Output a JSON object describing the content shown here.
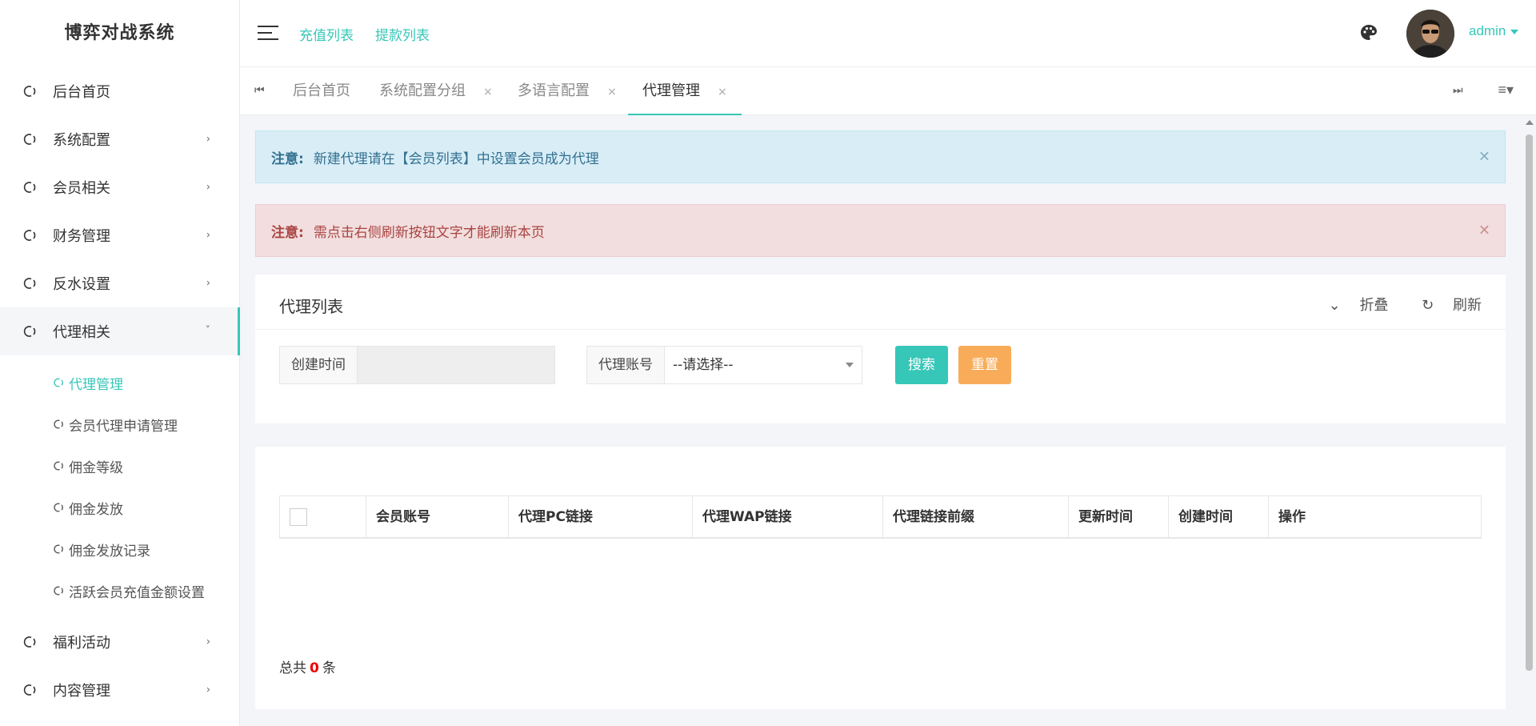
{
  "app": {
    "title": "博弈对战系统"
  },
  "sidebar": {
    "items": [
      {
        "label": "后台首页",
        "has_children": false
      },
      {
        "label": "系统配置",
        "has_children": true
      },
      {
        "label": "会员相关",
        "has_children": true
      },
      {
        "label": "财务管理",
        "has_children": true
      },
      {
        "label": "反水设置",
        "has_children": true
      },
      {
        "label": "代理相关",
        "has_children": true,
        "expanded": true
      },
      {
        "label": "福利活动",
        "has_children": true
      },
      {
        "label": "内容管理",
        "has_children": true
      }
    ],
    "sub_items": [
      {
        "label": "代理管理",
        "active": true
      },
      {
        "label": "会员代理申请管理"
      },
      {
        "label": "佣金等级"
      },
      {
        "label": "佣金发放"
      },
      {
        "label": "佣金发放记录"
      },
      {
        "label": "活跃会员充值金额设置"
      }
    ]
  },
  "header": {
    "links": [
      "充值列表",
      "提款列表"
    ],
    "user": "admin"
  },
  "tabs": {
    "items": [
      {
        "label": "后台首页",
        "closable": false
      },
      {
        "label": "系统配置分组",
        "closable": true
      },
      {
        "label": "多语言配置",
        "closable": true
      },
      {
        "label": "代理管理",
        "closable": true,
        "active": true
      }
    ],
    "close_glyph": "×"
  },
  "alerts": {
    "info": {
      "label": "注意:",
      "text": "新建代理请在【会员列表】中设置会员成为代理"
    },
    "danger": {
      "label": "注意:",
      "text": "需点击右侧刷新按钮文字才能刷新本页"
    }
  },
  "search_panel": {
    "title": "代理列表",
    "collapse_label": "折叠",
    "refresh_label": "刷新",
    "created_label": "创建时间",
    "agent_label": "代理账号",
    "agent_select_value": "--请选择--",
    "search_button": "搜索",
    "reset_button": "重置"
  },
  "table": {
    "columns": [
      "会员账号",
      "代理PC链接",
      "代理WAP链接",
      "代理链接前缀",
      "更新时间",
      "创建时间",
      "操作"
    ],
    "total_prefix": "总共",
    "total_count": "0",
    "total_suffix": "条"
  },
  "colors": {
    "accent": "#36c7b8",
    "warning": "#f8ac59",
    "info_bg": "#d9edf7",
    "danger_bg": "#f2dede"
  }
}
